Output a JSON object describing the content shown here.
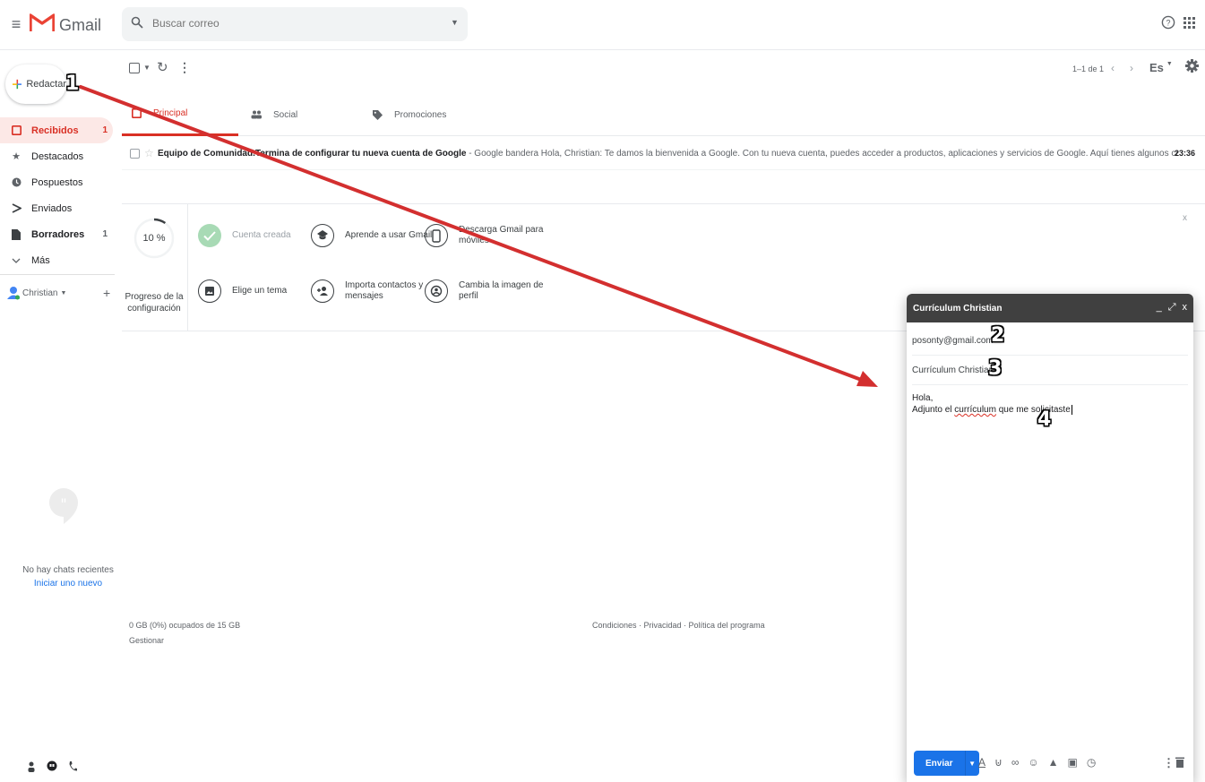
{
  "header": {
    "app_name": "Gmail",
    "search_placeholder": "Buscar correo"
  },
  "sidebar": {
    "compose_label": "Redactar",
    "items": [
      {
        "label": "Recibidos",
        "count": "1",
        "icon": "inbox-icon",
        "active": true
      },
      {
        "label": "Destacados",
        "count": "",
        "icon": "star-icon"
      },
      {
        "label": "Pospuestos",
        "count": "",
        "icon": "clock-icon"
      },
      {
        "label": "Enviados",
        "count": "",
        "icon": "send-icon"
      },
      {
        "label": "Borradores",
        "count": "1",
        "icon": "draft-icon"
      },
      {
        "label": "Más",
        "count": "",
        "icon": "chevron-down-icon"
      }
    ],
    "account_name": "Christian",
    "chat_empty": "No hay chats recientes",
    "chat_start": "Iniciar uno nuevo"
  },
  "toolbar": {
    "pagination": "1–1 de 1",
    "input_tools": "Es"
  },
  "tabs": [
    {
      "label": "Principal",
      "icon": "inbox-icon",
      "active": true
    },
    {
      "label": "Social",
      "icon": "people-icon"
    },
    {
      "label": "Promociones",
      "icon": "tag-icon"
    }
  ],
  "email": {
    "sender": "Equipo de Comunidad.",
    "subject": "Termina de configurar tu nueva cuenta de Google",
    "snippet": " - Google bandera Hola, Christian: Te damos la bienvenida a Google. Con tu nueva cuenta, puedes acceder a productos, aplicaciones y servicios de Google. Aquí tienes algunos consejos para empezar. Controla",
    "time": "23:36"
  },
  "setup": {
    "progress_value": "10 %",
    "progress_fraction": 0.1,
    "progress_label": "Progreso de la configuración",
    "items": [
      {
        "label": "Cuenta creada",
        "icon": "check-icon",
        "done": true
      },
      {
        "label": "Aprende a usar Gmail",
        "icon": "graduation-cap-icon"
      },
      {
        "label": "Descarga Gmail para móviles",
        "icon": "phone-icon"
      },
      {
        "label": "Elige un tema",
        "icon": "image-icon"
      },
      {
        "label": "Importa contactos y mensajes",
        "icon": "add-person-icon"
      },
      {
        "label": "Cambia la imagen de perfil",
        "icon": "account-icon"
      }
    ],
    "close": "x"
  },
  "footer": {
    "storage": "0 GB (0%) ocupados de 15 GB",
    "manage": "Gestionar",
    "links": "Condiciones · Privacidad · Política del programa"
  },
  "compose": {
    "title": "Currículum Christian",
    "to": "posonty@gmail.com",
    "subject": "Currículum Christian",
    "body_line1": "Hola,",
    "body_line2_pre": "Adjunto el ",
    "body_line2_word": "currículum",
    "body_line2_post": " que me solicitaste",
    "send_label": "Enviar"
  },
  "annotations": {
    "marker_1": "1",
    "marker_2": "2",
    "marker_3": "3",
    "marker_4": "4",
    "arrow_color": "#d32f2f"
  },
  "colors": {
    "accent_red": "#d93025",
    "accent_blue": "#1a73e8",
    "compose_header": "#404040"
  }
}
